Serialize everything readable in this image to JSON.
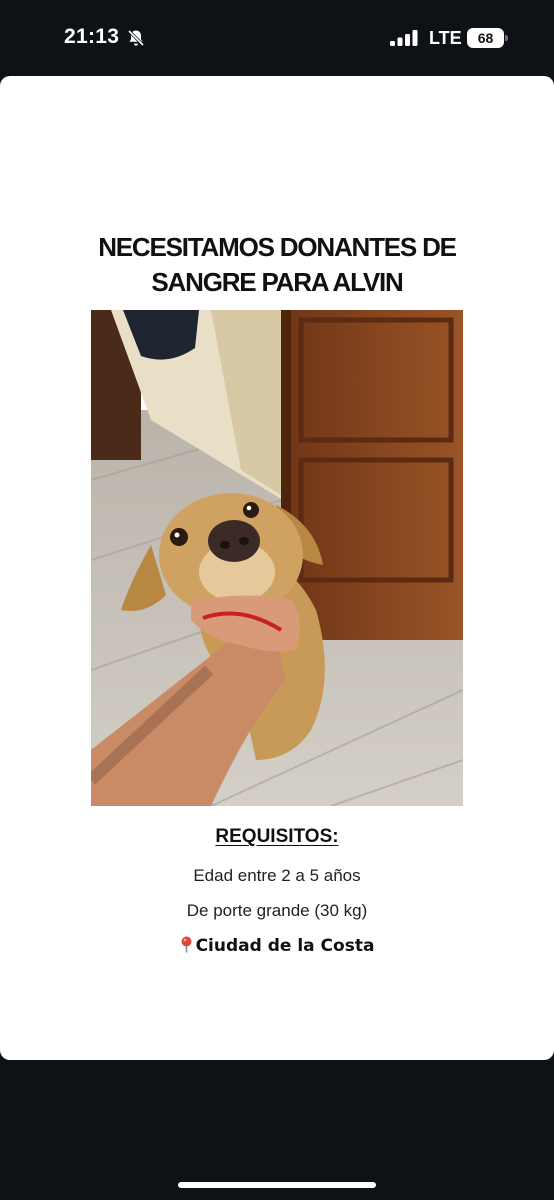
{
  "status_bar": {
    "time": "21:13",
    "network": "LTE",
    "battery": "68",
    "icons": [
      "bell-slash-icon",
      "cellular-signal-icon",
      "battery-icon"
    ]
  },
  "post": {
    "title_line1": "NECESITAMOS DONANTES DE",
    "title_line2": "SANGRE PARA ALVIN",
    "photo_subject": "dog-photo",
    "requirements": {
      "heading": "REQUISITOS:",
      "age": "Edad entre 2 a 5 años",
      "size": "De porte grande (30 kg)"
    },
    "location": "Ciudad de la Costa",
    "location_icon": "map-pin-icon"
  },
  "colors": {
    "background": "#0e1116",
    "card": "#ffffff",
    "text": "#111111",
    "pin": "#e0453b"
  }
}
